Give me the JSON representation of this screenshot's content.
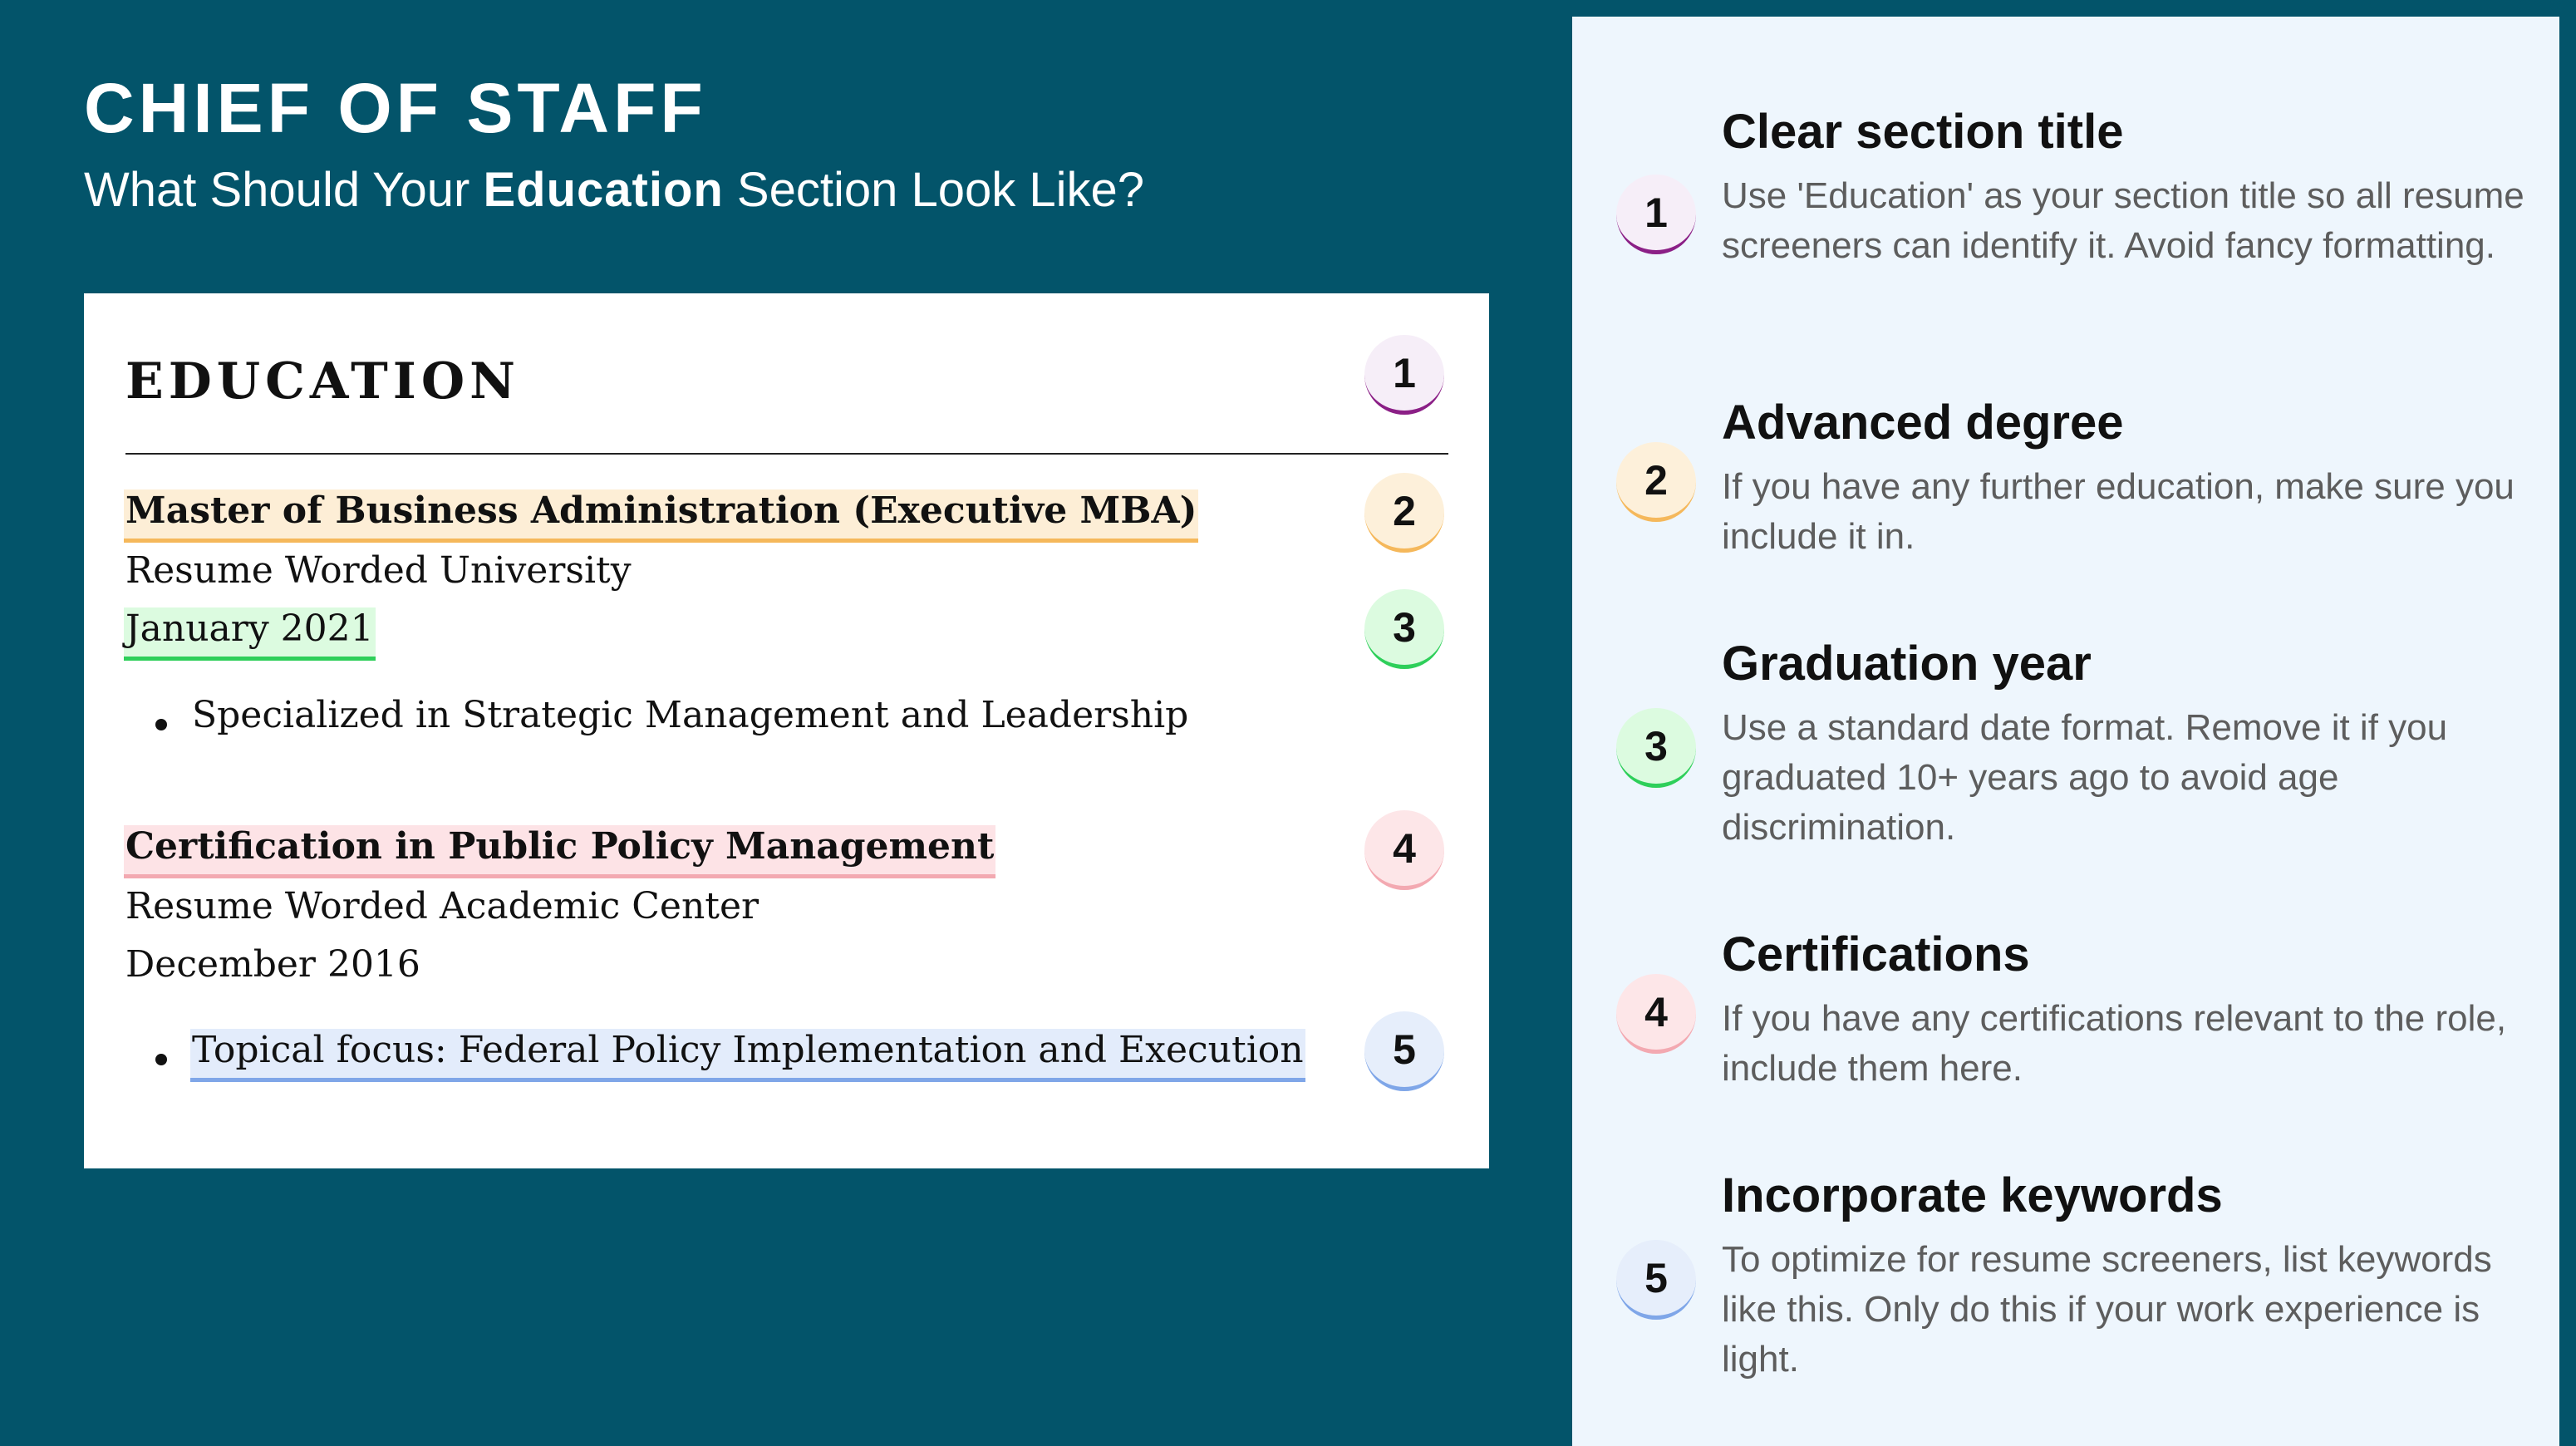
{
  "header": {
    "role_title": "CHIEF OF STAFF",
    "subtitle_pre": "What Should Your ",
    "subtitle_bold": "Education",
    "subtitle_post": " Section Look Like?"
  },
  "resume": {
    "section_heading": "EDUCATION",
    "entries": [
      {
        "degree": "Master of Business Administration (Executive MBA)",
        "school": "Resume Worded University",
        "date": "January 2021",
        "bullet": "Specialized in Strategic Management and Leadership"
      },
      {
        "degree": "Certification in Public Policy Management",
        "school": "Resume Worded Academic Center",
        "date": "December 2016",
        "bullet": "Topical focus: Federal Policy Implementation and Execution"
      }
    ],
    "badges": [
      "1",
      "2",
      "3",
      "4",
      "5"
    ]
  },
  "tips": [
    {
      "number": "1",
      "title": "Clear section title",
      "text": "Use 'Education' as your section title so all resume screeners can identify it. Avoid fancy formatting."
    },
    {
      "number": "2",
      "title": "Advanced degree",
      "text": "If you have any further education, make sure you include it in."
    },
    {
      "number": "3",
      "title": "Graduation year",
      "text": "Use a standard date format. Remove it if you graduated 10+ years ago to avoid age discrimination."
    },
    {
      "number": "4",
      "title": "Certifications",
      "text": "If you have any certifications relevant to the role, include them here."
    },
    {
      "number": "5",
      "title": "Incorporate keywords",
      "text": "To optimize for resume screeners, list keywords like this. Only do this if your work experience is light."
    }
  ],
  "colors": {
    "background": "#03546a",
    "panel": "#eef6fd",
    "badge_1": "#8b1f86",
    "badge_2": "#f5b85b",
    "badge_3": "#2ecf5a",
    "badge_4": "#f3a9b1",
    "badge_5": "#7fa6e8"
  }
}
